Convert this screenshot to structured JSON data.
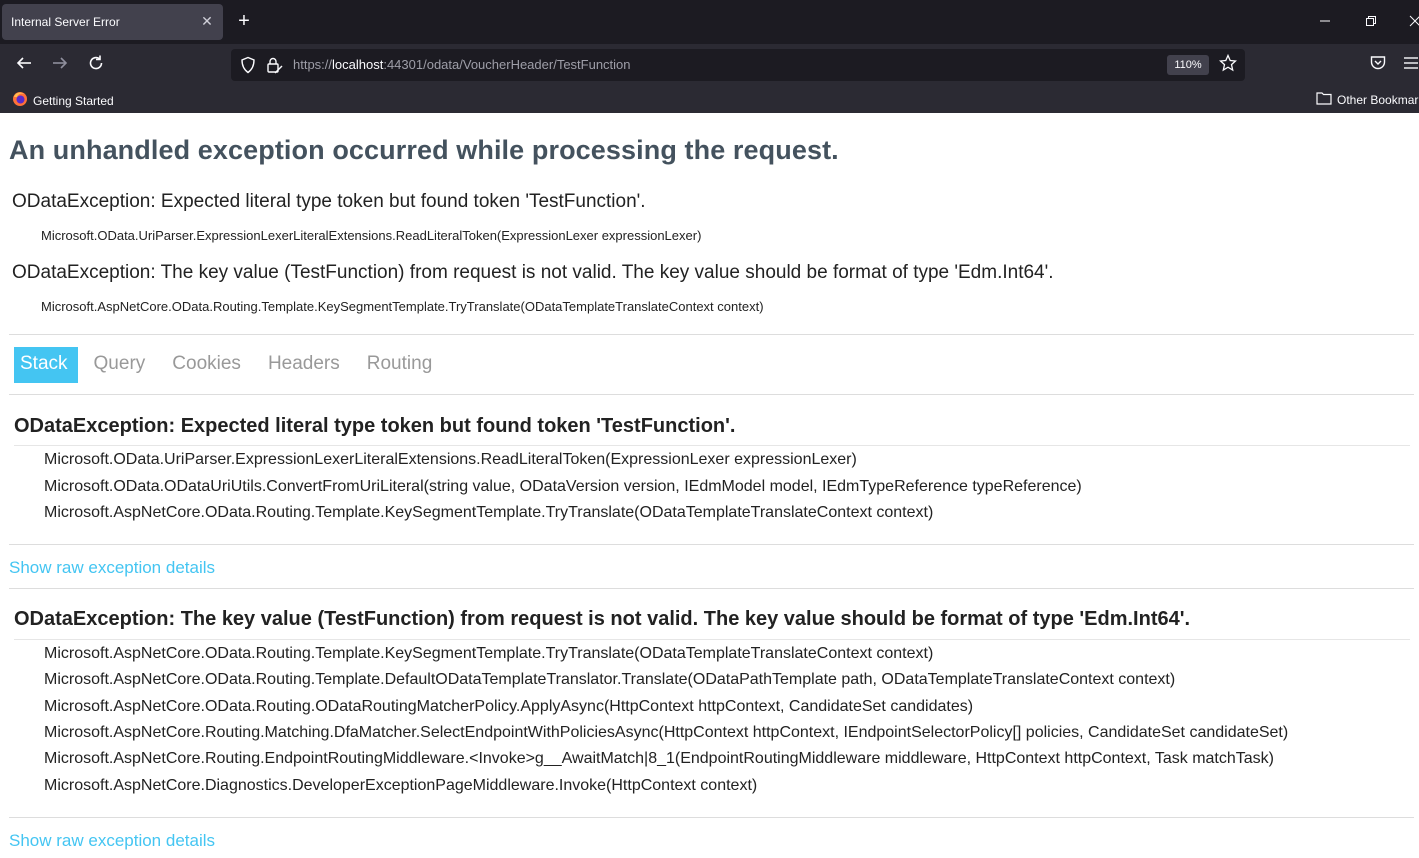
{
  "browser": {
    "tab_title": "Internal Server Error",
    "tab_close": "✕",
    "new_tab": "+",
    "url_prefix": "https://",
    "url_host": "localhost",
    "url_rest": ":44301/odata/VoucherHeader/TestFunction",
    "zoom": "110%",
    "bookmark_getting_started": "Getting Started",
    "bookmark_other": "Other Bookmarks"
  },
  "page": {
    "title": "An unhandled exception occurred while processing the request.",
    "summaries": [
      {
        "message": "ODataException: Expected literal type token but found token 'TestFunction'.",
        "location": "Microsoft.OData.UriParser.ExpressionLexerLiteralExtensions.ReadLiteralToken(ExpressionLexer expressionLexer)"
      },
      {
        "message": "ODataException: The key value (TestFunction) from request is not valid. The key value should be format of type 'Edm.Int64'.",
        "location": "Microsoft.AspNetCore.OData.Routing.Template.KeySegmentTemplate.TryTranslate(ODataTemplateTranslateContext context)"
      }
    ],
    "tabs": [
      "Stack",
      "Query",
      "Cookies",
      "Headers",
      "Routing"
    ],
    "active_tab": "Stack",
    "exceptions": [
      {
        "title": "ODataException: Expected literal type token but found token 'TestFunction'.",
        "frames": [
          "Microsoft.OData.UriParser.ExpressionLexerLiteralExtensions.ReadLiteralToken(ExpressionLexer expressionLexer)",
          "Microsoft.OData.ODataUriUtils.ConvertFromUriLiteral(string value, ODataVersion version, IEdmModel model, IEdmTypeReference typeReference)",
          "Microsoft.AspNetCore.OData.Routing.Template.KeySegmentTemplate.TryTranslate(ODataTemplateTranslateContext context)"
        ],
        "raw_link": "Show raw exception details"
      },
      {
        "title": "ODataException: The key value (TestFunction) from request is not valid. The key value should be format of type 'Edm.Int64'.",
        "frames": [
          "Microsoft.AspNetCore.OData.Routing.Template.KeySegmentTemplate.TryTranslate(ODataTemplateTranslateContext context)",
          "Microsoft.AspNetCore.OData.Routing.Template.DefaultODataTemplateTranslator.Translate(ODataPathTemplate path, ODataTemplateTranslateContext context)",
          "Microsoft.AspNetCore.OData.Routing.ODataRoutingMatcherPolicy.ApplyAsync(HttpContext httpContext, CandidateSet candidates)",
          "Microsoft.AspNetCore.Routing.Matching.DfaMatcher.SelectEndpointWithPoliciesAsync(HttpContext httpContext, IEndpointSelectorPolicy[] policies, CandidateSet candidateSet)",
          "Microsoft.AspNetCore.Routing.EndpointRoutingMiddleware.<Invoke>g__AwaitMatch|8_1(EndpointRoutingMiddleware middleware, HttpContext httpContext, Task matchTask)",
          "Microsoft.AspNetCore.Diagnostics.DeveloperExceptionPageMiddleware.Invoke(HttpContext context)"
        ],
        "raw_link": "Show raw exception details"
      }
    ]
  },
  "colors": {
    "accent": "#44c5f2",
    "title": "#44525e",
    "chrome_bg": "#1c1b22",
    "toolbar_bg": "#2b2a33"
  }
}
